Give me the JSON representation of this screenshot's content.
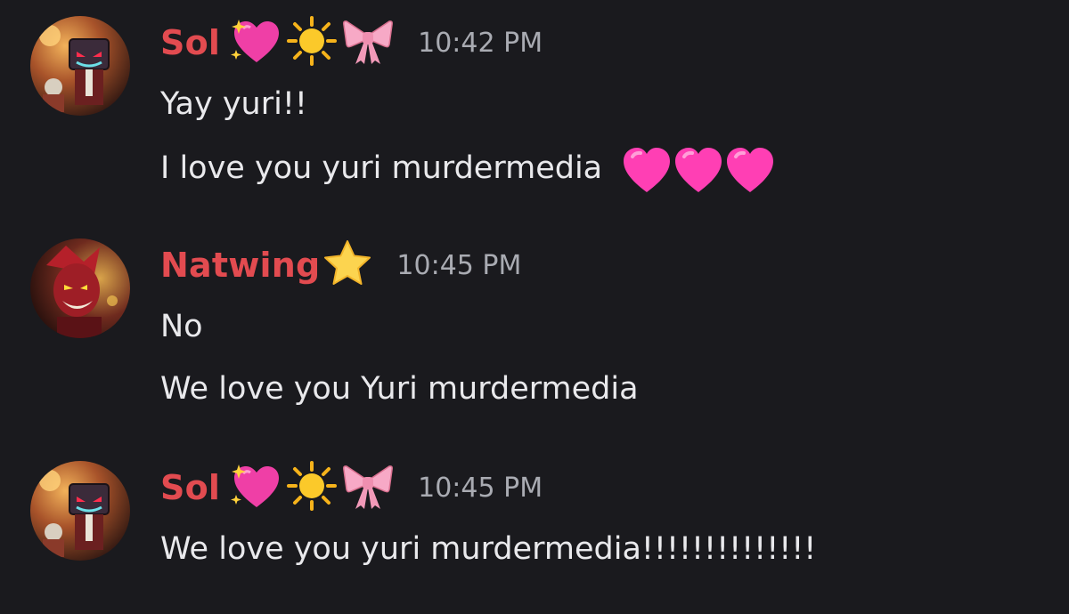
{
  "messages": [
    {
      "author": "Sol",
      "badges": [
        "sparkling-heart-icon",
        "sun-icon",
        "ribbon-icon"
      ],
      "time": "10:42 PM",
      "lines": [
        "Yay yuri!!",
        "I love you yuri murdermedia"
      ],
      "trailing_emoji": [
        "pink-heart-icon",
        "pink-heart-icon",
        "pink-heart-icon"
      ]
    },
    {
      "author": "Natwing",
      "badges": [
        "star-icon"
      ],
      "time": "10:45 PM",
      "lines": [
        "No",
        "We love you Yuri murdermedia"
      ]
    },
    {
      "author": "Sol",
      "badges": [
        "sparkling-heart-icon",
        "sun-icon",
        "ribbon-icon"
      ],
      "time": "10:45 PM",
      "lines": [
        "We love you yuri murdermedia!!!!!!!!!!!!!!"
      ]
    }
  ],
  "colors": {
    "background": "#1a1a1e",
    "username": "#e24b50",
    "timestamp": "#a9abb2",
    "message_text": "#e9e9ec",
    "pink_heart": "#ff3fb4"
  }
}
